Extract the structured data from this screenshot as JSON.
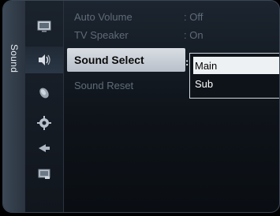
{
  "category": {
    "label": "Sound"
  },
  "icons": [
    {
      "name": "picture-icon"
    },
    {
      "name": "sound-icon"
    },
    {
      "name": "channel-icon"
    },
    {
      "name": "setup-icon"
    },
    {
      "name": "input-icon"
    },
    {
      "name": "application-icon"
    }
  ],
  "menu": {
    "items": [
      {
        "label": "Auto Volume",
        "value": ": Off"
      },
      {
        "label": "TV Speaker",
        "value": ": On"
      },
      {
        "label": "Sound Select",
        "value": ":"
      },
      {
        "label": "Sound Reset",
        "value": ""
      }
    ],
    "selected_index": 2
  },
  "dropdown": {
    "options": [
      "Main",
      "Sub"
    ],
    "highlighted_index": 0
  },
  "colors": {
    "selection_bar": "#c9cfd6",
    "dimmed_text": "#5f6b79",
    "background": "#0e1319"
  }
}
